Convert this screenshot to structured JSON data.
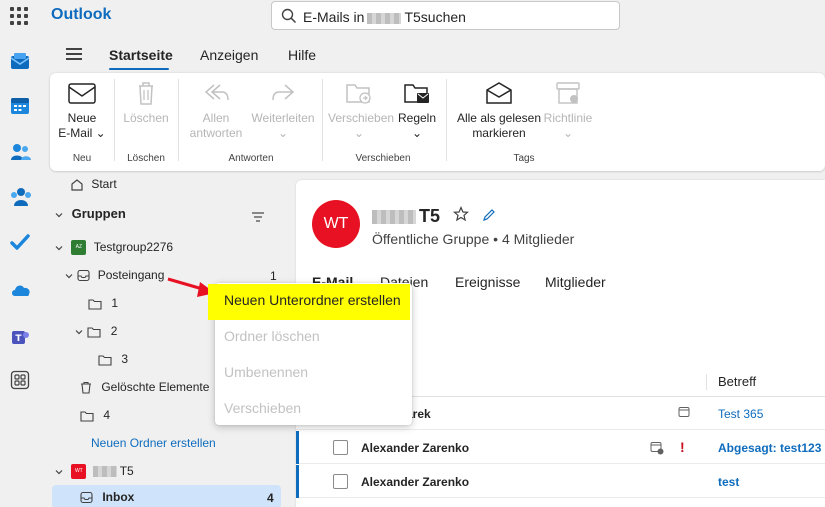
{
  "app": {
    "name": "Outlook"
  },
  "search": {
    "text_prefix": "E-Mails in",
    "text_suffix": "T5suchen"
  },
  "tabs": [
    {
      "label": "Startseite",
      "active": true
    },
    {
      "label": "Anzeigen"
    },
    {
      "label": "Hilfe"
    }
  ],
  "ribbon": {
    "new_email": {
      "line1": "Neue",
      "line2": "E-Mail"
    },
    "delete": "Löschen",
    "reply_all": {
      "line1": "Allen",
      "line2": "antworten"
    },
    "forward": "Weiterleiten",
    "move": "Verschieben",
    "rules": "Regeln",
    "mark_all_read": {
      "line1": "Alle als gelesen",
      "line2": "markieren"
    },
    "policy": "Richtlinie",
    "groups": {
      "new": "Neu",
      "delete": "Löschen",
      "respond": "Antworten",
      "move": "Verschieben",
      "tags": "Tags"
    }
  },
  "folders": {
    "home": "Start",
    "groups_header": "Gruppen",
    "group1": {
      "badge": "AZ",
      "name": "Testgroup2276"
    },
    "inbox": {
      "label": "Posteingang",
      "count": "1"
    },
    "sub1": "1",
    "sub2": "2",
    "sub3": "3",
    "deleted": "Gelöschte Elemente",
    "sub4": "4",
    "new_folder": "Neuen Ordner erstellen",
    "group2": {
      "badge": "WT",
      "name": "T5"
    },
    "inbox2": {
      "label": "Inbox",
      "count": "4"
    }
  },
  "group_header": {
    "initials": "WT",
    "name": "T5",
    "subtitle": "Öffentliche Gruppe • 4 Mitglieder",
    "tabs": [
      "E-Mail",
      "Dateien",
      "Ereignisse",
      "Mitglieder"
    ]
  },
  "message_list": {
    "subject_header": "Betreff",
    "rows": [
      {
        "from": "Marek",
        "subject": "Test 365"
      },
      {
        "from": "Alexander Zarenko",
        "subject": "Abgesagt: test123"
      },
      {
        "from": "Alexander Zarenko",
        "subject": "test"
      }
    ]
  },
  "context_menu": {
    "items": [
      {
        "label": "Neuen Unterordner erstellen",
        "enabled": true
      },
      {
        "label": "Ordner löschen",
        "enabled": false
      },
      {
        "label": "Umbenennen",
        "enabled": false
      },
      {
        "label": "Verschieben",
        "enabled": false
      }
    ]
  },
  "colors": {
    "accent": "#0f6cbd",
    "highlight": "#ffff00",
    "avatar": "#e81123",
    "important": "#c50f1f"
  }
}
